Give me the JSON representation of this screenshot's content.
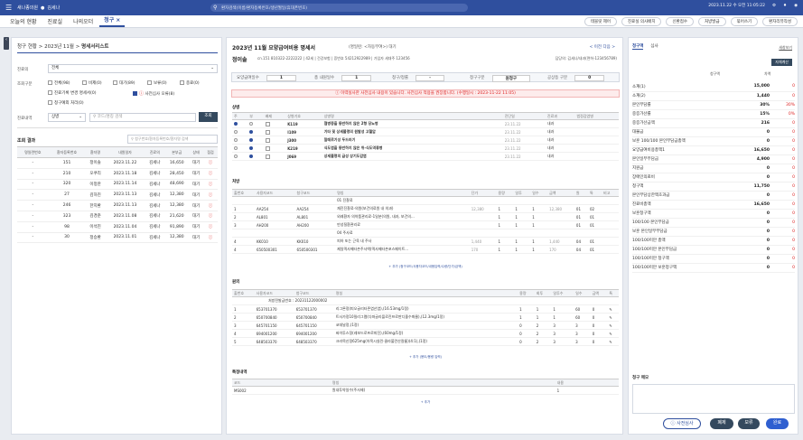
{
  "topbar": {
    "app_name": "새나종의원",
    "user": "김세나",
    "search_placeholder": "환자검색(이름/환자등록번호/생년월일/휴대폰번호)",
    "datetime": "2023.11.22 수 오전 11:05:22",
    "icons": [
      "bell-icon",
      "settings-icon",
      "user-icon"
    ]
  },
  "tabs": [
    "오늘의 현황",
    "진료실",
    "나의오더",
    "청구"
  ],
  "tab_actions": [
    "테블릿 제어",
    "진료실 의사배치",
    "신환접수",
    "처방발급",
    "묶어쓰기",
    "환자리뷰작성"
  ],
  "left": {
    "breadcrumb_prefix": "청구 현황 > 2023년 11월 >",
    "breadcrumb_current": "명세서리스트",
    "label_type": "진료의",
    "type_value": "전체",
    "label_cond": "조회구분",
    "checks": [
      {
        "label": "전체(98)",
        "on": false
      },
      {
        "label": "비제(0)",
        "on": false
      },
      {
        "label": "대기(89)",
        "on": false
      },
      {
        "label": "보류(0)",
        "on": false
      },
      {
        "label": "종료(0)",
        "on": false
      },
      {
        "label": "진료기록 변경 명세서(0)",
        "on": false
      },
      {
        "label": "사전심사 오류(8)",
        "on": true
      },
      {
        "label": "청구예외 처리(0)",
        "on": false
      }
    ],
    "label_detail": "진료내역",
    "detail_value": "상병",
    "detail_placeholder": "코드/명칭 검색",
    "search_btn": "조회",
    "result_label": "조회 결과",
    "result_placeholder": "청구번호/환자등록번호/환자명 검색",
    "headers": [
      "명일련번호",
      "환자등록번호",
      "환자명",
      "내원일자",
      "진료의",
      "본부금",
      "상태",
      "점검"
    ],
    "rows": [
      [
        "-",
        "151",
        "정이솔",
        "2023.11.22",
        "김세나",
        "16,650",
        "대기"
      ],
      [
        "-",
        "210",
        "오쿠리",
        "2023.11.18",
        "김세나",
        "28,450",
        "대기"
      ],
      [
        "-",
        "320",
        "이정란",
        "2023.11.14",
        "김세나",
        "48,690",
        "대기"
      ],
      [
        "-",
        "27",
        "김하진",
        "2023.11.13",
        "김세나",
        "12,380",
        "대기"
      ],
      [
        "-",
        "246",
        "한지환",
        "2023.11.13",
        "김세나",
        "12,380",
        "대기"
      ],
      [
        "-",
        "323",
        "김경준",
        "2023.11.08",
        "김세나",
        "21,620",
        "대기"
      ],
      [
        "-",
        "98",
        "이석진",
        "2023.11.04",
        "김세나",
        "91,890",
        "대기"
      ],
      [
        "-",
        "30",
        "정승환",
        "2023.11.01",
        "김세나",
        "12,380",
        "대기"
      ]
    ]
  },
  "mid": {
    "title": "2023년 11월 요양급여비용 명세서",
    "subtitle": "(명일련: <자동부여>) 대기",
    "patient_name": "정이솔",
    "patient_meta": "cn.151   810322-2222222 | 42세 | 건강보험 | 증번호 54212922989 | 가입자 세대주 123456",
    "nav": "< 이전   다음 >",
    "doctor": "담당의: 김세나/내과(면허-123456789)",
    "info_cells": [
      [
        "요양급여일수",
        "1"
      ],
      [
        "총 내원일수",
        "1"
      ],
      [
        "청구/정률",
        "-"
      ],
      [
        "청구구분",
        "원청구"
      ],
      [
        "공상등 구분",
        "0"
      ]
    ],
    "alert": "이력실사한 사전심사 내용이 있습니다. 사전심사 적용을 권장합니다. (수행일시 : 2023-11-22 11:05)",
    "disease_title": "상병",
    "disease_headers": [
      "주",
      "부",
      "배제",
      "상병기호",
      "상병명",
      "진단일",
      "진료과",
      "법정감염병"
    ],
    "diseases": [
      [
        "K119",
        "협병증을 동반하지 않은 2형 당뇨병",
        "23.11.22",
        "내과"
      ],
      [
        "I109",
        "기타 및 상세불명의 원발성 고혈압",
        "23.11.22",
        "내과"
      ],
      [
        "J300",
        "알레르기성 두드러기",
        "23.11.22",
        "내과"
      ],
      [
        "K219",
        "식도염을 동반하지 않은 위-식도역류병",
        "23.11.22",
        "내과"
      ],
      [
        "J069",
        "상세불명의 급성 상기도감염",
        "23.11.22",
        "내과"
      ]
    ],
    "proc_title": "처방",
    "proc_headers": [
      "출번호",
      "사용자코드",
      "청구코드",
      "명칭",
      "단가",
      "용량",
      "일투",
      "일수",
      "금액",
      "원",
      "특",
      "비고"
    ],
    "procs": [
      [
        "",
        "",
        "",
        "01 진찰료",
        "",
        "",
        "",
        "",
        "",
        "",
        "",
        ""
      ],
      [
        "1",
        "AA254",
        "AA254",
        "재진진찰료-의원(보건의료원 내 의과)",
        "12,380",
        "1",
        "1",
        "1",
        "12,380",
        "01",
        "02",
        ""
      ],
      [
        "2",
        "AL801",
        "AL801",
        "외래환자 의약품관리료-1일분(의원, 내과, 보건의...",
        "",
        "1",
        "1",
        "1",
        "",
        "01",
        "01",
        ""
      ],
      [
        "3",
        "AH200",
        "AH200",
        "만성질환관리료",
        "",
        "1",
        "1",
        "1",
        "",
        "01",
        "01",
        ""
      ],
      [
        "",
        "",
        "",
        "04 주사료",
        "",
        "",
        "",
        "",
        "",
        "",
        "",
        ""
      ],
      [
        "4",
        "KK010",
        "KK010",
        "피하 또는 근육 내 주사",
        "1,440",
        "1",
        "1",
        "1",
        "1,440",
        "04",
        "01",
        ""
      ],
      [
        "4",
        "650500301",
        "650500301",
        "제일덱사메타손주사액(덱사메타손포스페이트...",
        "170",
        "1",
        "1",
        "1",
        "170",
        "04",
        "01",
        ""
      ]
    ],
    "proc_footer": "+ 추가 (청구코드/사용자코드/내용입력/수량/단가/금액)",
    "presc_title": "원외",
    "presc_headers": [
      "출번호",
      "사용자코드",
      "청구코드",
      "명칭",
      "용량",
      "회투",
      "일투수",
      "일수",
      "금액",
      "특"
    ],
    "presc_header_row": "처방전발급번호 : 20231122000002",
    "prescs": [
      [
        "1",
        "653701370",
        "653701370",
        "리그론정(피오글리타존염산염),(16.53mg/1정)",
        "1",
        "1",
        "1",
        "60"
      ],
      [
        "2",
        "650700840",
        "650700840",
        "트사가정10밀리그램(다파글리플로진프로판디올수화물),(12.3mg/1정)",
        "1",
        "1",
        "1",
        "60"
      ],
      [
        "3",
        "645701150",
        "645701150",
        "코데날정,(1정)",
        "0",
        "2",
        "3",
        "3"
      ],
      [
        "4",
        "694001200",
        "694001200",
        "싸이투스정(레보드로프로피진),(60mg/1정)",
        "0",
        "2",
        "3",
        "3"
      ],
      [
        "5",
        "648503370",
        "648503370",
        "크라목신정625mg(아목시실린·클라불란산칼륨)(4:1),(1정)",
        "0",
        "2",
        "3",
        "3"
      ]
    ],
    "presc_footer": "+ 추가 (용도/용량 입력)",
    "special_title": "특정내역",
    "special_headers": [
      "코드",
      "명칭",
      "내용"
    ],
    "special_rows": [
      [
        "MS002",
        "원내투약일수(주사제)",
        "1"
      ]
    ],
    "special_footer": "+ 추가"
  },
  "right": {
    "tabs": [
      "청구액",
      "심사"
    ],
    "link": "새창보기",
    "calc_btn": "자체계산",
    "headers": [
      "청구액",
      "차액"
    ],
    "rows": [
      [
        "소계(1)",
        "15,000",
        "0"
      ],
      [
        "소계(2)",
        "1,440",
        "0"
      ],
      [
        "본인부담률",
        "30%",
        "30%"
      ],
      [
        "중증가산률",
        "15%",
        "0%"
      ],
      [
        "중증가산금액",
        "216",
        "0"
      ],
      [
        "대불금",
        "0",
        "0"
      ],
      [
        "보훈 100/100 본인부담금총액",
        "0",
        "0"
      ],
      [
        "요양급여비용총액1",
        "16,650",
        "0"
      ],
      [
        "본인일부부담금",
        "4,900",
        "0"
      ],
      [
        "지원금",
        "0",
        "0"
      ],
      [
        "장애인의료비",
        "0",
        "0"
      ],
      [
        "청구액",
        "11,750",
        "0"
      ],
      [
        "본인부담상한액초과금",
        "0",
        "0"
      ],
      [
        "진료비총액",
        "16,650",
        "0"
      ],
      [
        "보훈청구액",
        "0",
        "0"
      ],
      [
        "100/100 본인부담금",
        "0",
        "0"
      ],
      [
        "보훈 본인일부부담금",
        "0",
        "0"
      ],
      [
        "100/100미만 총액",
        "0",
        "0"
      ],
      [
        "100/100미만 본인부담금",
        "0",
        "0"
      ],
      [
        "100/100미만 청구액",
        "0",
        "0"
      ],
      [
        "100/100미만 보훈청구액",
        "0",
        "0"
      ]
    ],
    "memo_label": "청구 메모"
  },
  "bottom": {
    "precheck": "사전심사",
    "hold": "보류",
    "save": "보류",
    "complete": "완료"
  }
}
